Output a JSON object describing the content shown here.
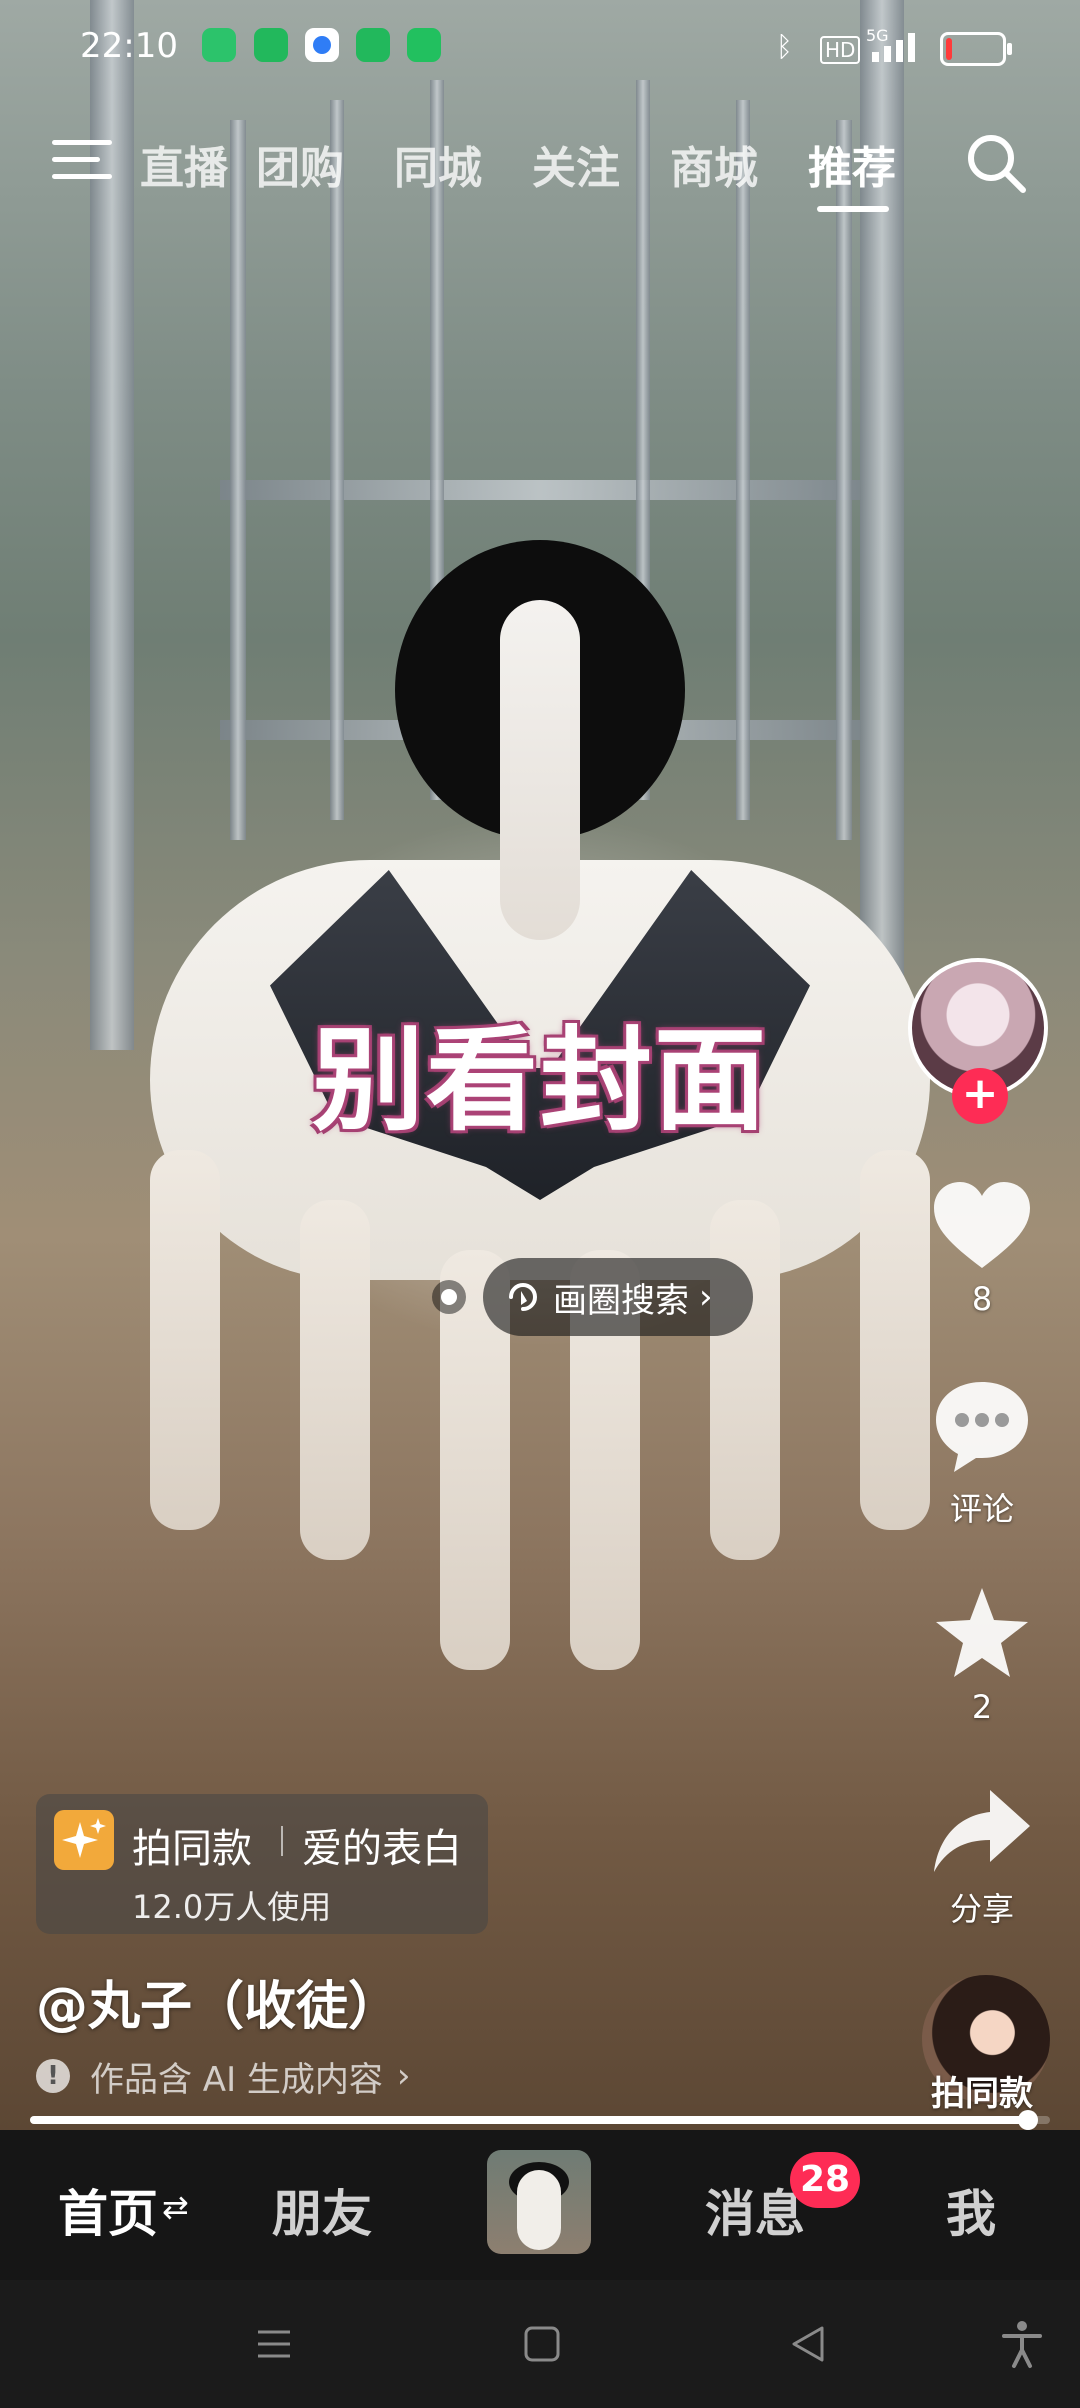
{
  "status_bar": {
    "time": "22:10",
    "network_hd": "HD",
    "network_gen": "5G",
    "battery_level": 0.12,
    "battery_color": "#ff3b3b",
    "icons": [
      "battery-saver-icon",
      "green-shield-icon",
      "app-icon",
      "upload-icon",
      "grid-app-icon",
      "bluetooth-icon",
      "signal-icon"
    ]
  },
  "top_nav": {
    "tabs": [
      {
        "label": "直播"
      },
      {
        "label": "团购"
      },
      {
        "label": "同城"
      },
      {
        "label": "关注"
      },
      {
        "label": "商城"
      },
      {
        "label": "推荐"
      }
    ],
    "active_tab": "推荐"
  },
  "video": {
    "caption": "别看封面",
    "circle_search_label": "画圈搜索"
  },
  "right_rail": {
    "like_count": "8",
    "comment_label": "评论",
    "favorite_count": "2",
    "share_label": "分享",
    "same_style_label": "拍同款"
  },
  "template": {
    "label": "拍同款",
    "name": "爱的表白",
    "usage": "12.0万人使用"
  },
  "author": "@丸子（收徒）",
  "ai_notice": "作品含 AI 生成内容",
  "progress": 0.978,
  "bottom_tabs": {
    "home": "首页",
    "friends": "朋友",
    "messages": "消息",
    "me": "我",
    "messages_badge": "28"
  },
  "colors": {
    "accent": "#fe2c55",
    "template_icon": "#f2a93b"
  }
}
